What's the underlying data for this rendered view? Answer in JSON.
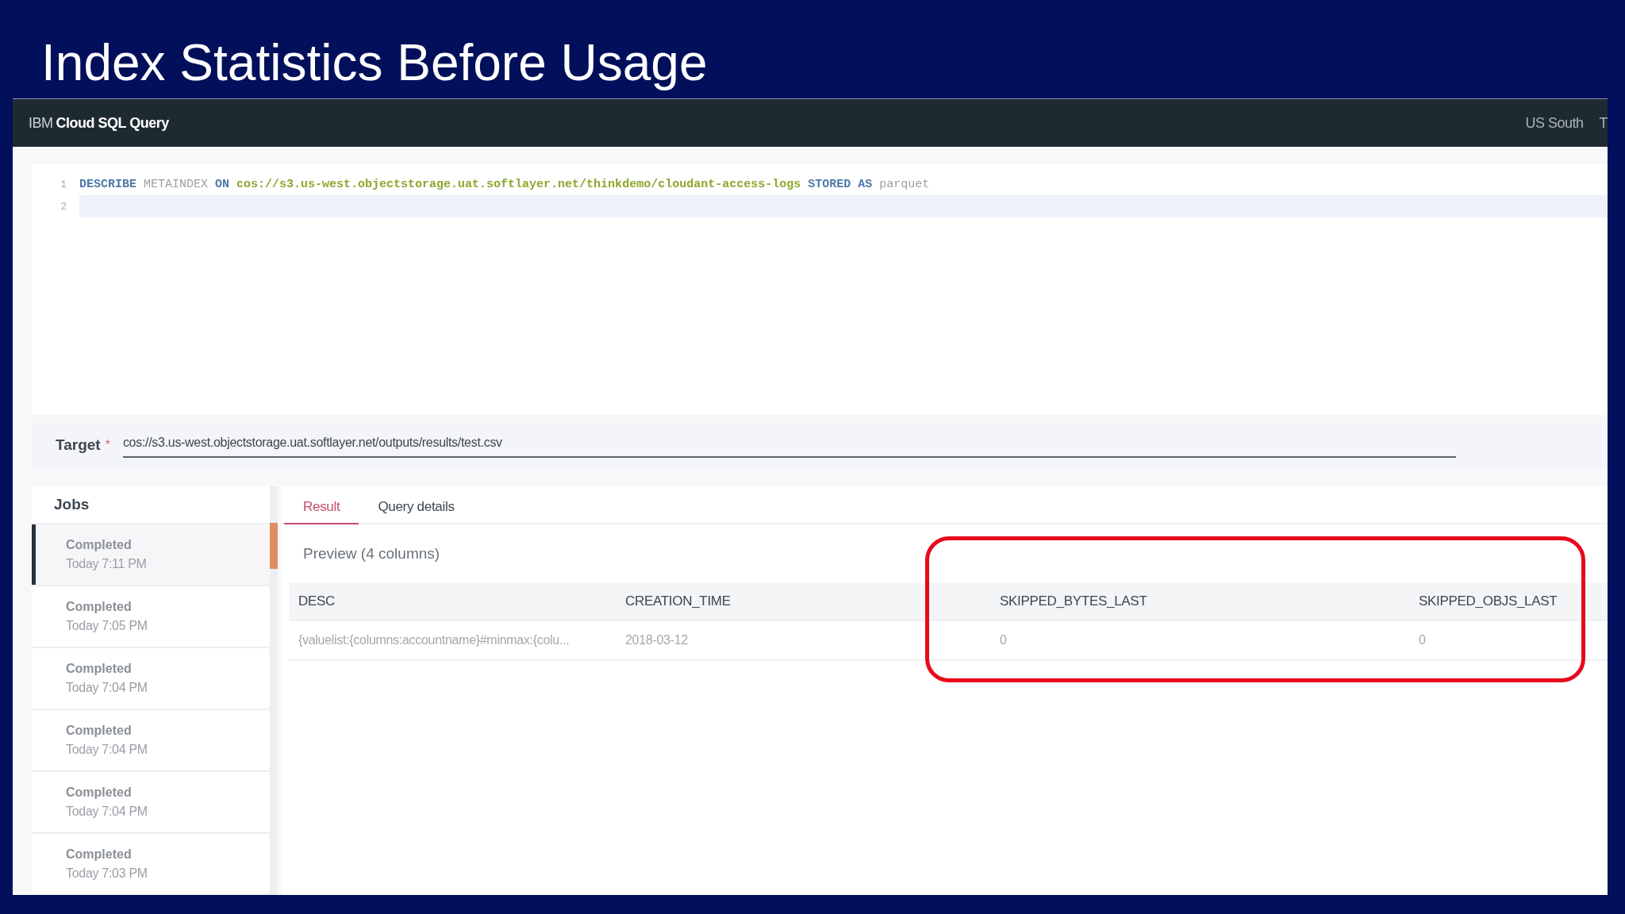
{
  "slide_title": "Index Statistics Before Usage",
  "app_header": {
    "brand_prefix": "IBM",
    "brand_name": "Cloud SQL Query",
    "right_items": [
      "US South",
      "T"
    ]
  },
  "editor": {
    "lines": [
      {
        "number": "1",
        "tokens": [
          {
            "kind": "keyword",
            "text": "DESCRIBE"
          },
          {
            "kind": "plain",
            "text": "METAINDEX"
          },
          {
            "kind": "keyword",
            "text": "ON"
          },
          {
            "kind": "string",
            "text": "cos://s3.us-west.objectstorage.uat.softlayer.net/thinkdemo/cloudant-access-logs"
          },
          {
            "kind": "keyword",
            "text": "STORED"
          },
          {
            "kind": "keyword",
            "text": "AS"
          },
          {
            "kind": "plain",
            "text": "parquet"
          }
        ],
        "selected": false
      },
      {
        "number": "2",
        "selected": true
      }
    ]
  },
  "target": {
    "label": "Target",
    "required_mark": "*",
    "value": "cos://s3.us-west.objectstorage.uat.softlayer.net/outputs/results/test.csv"
  },
  "jobs": {
    "title": "Jobs",
    "items": [
      {
        "status": "Completed",
        "time": "Today 7:11 PM",
        "selected": true
      },
      {
        "status": "Completed",
        "time": "Today 7:05 PM",
        "selected": false
      },
      {
        "status": "Completed",
        "time": "Today 7:04 PM",
        "selected": false
      },
      {
        "status": "Completed",
        "time": "Today 7:04 PM",
        "selected": false
      },
      {
        "status": "Completed",
        "time": "Today 7:04 PM",
        "selected": false
      },
      {
        "status": "Completed",
        "time": "Today 7:03 PM",
        "selected": false
      }
    ]
  },
  "tabs": [
    {
      "label": "Result",
      "selected": true
    },
    {
      "label": "Query details",
      "selected": false
    }
  ],
  "preview_title": "Preview (4 columns)",
  "table": {
    "columns": [
      "DESC",
      "CREATION_TIME",
      "SKIPPED_BYTES_LAST",
      "SKIPPED_OBJS_LAST"
    ],
    "rows": [
      [
        "{valuelist:{columns:accountname}#minmax:{colu...",
        "2018-03-12",
        "0",
        "0"
      ]
    ]
  },
  "highlight": {
    "shown": true
  }
}
